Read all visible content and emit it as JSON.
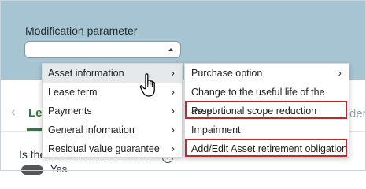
{
  "modification": {
    "label": "Modification parameter",
    "selected_value": ""
  },
  "tabs": {
    "active_label": "Le",
    "right_partial_label": "der"
  },
  "question": {
    "text": "Is there an identified asset?",
    "answer_label": "Yes"
  },
  "menu_left": {
    "items": [
      {
        "label": "Asset information",
        "has_submenu": true
      },
      {
        "label": "Lease term",
        "has_submenu": true
      },
      {
        "label": "Payments",
        "has_submenu": true
      },
      {
        "label": "General information",
        "has_submenu": true
      },
      {
        "label": "Residual value guarantee",
        "has_submenu": true
      }
    ],
    "hovered_index": 0
  },
  "menu_right": {
    "items": [
      {
        "label": "Purchase option",
        "has_submenu": true
      },
      {
        "label": "Change to the useful life of the asset",
        "has_submenu": false
      },
      {
        "label": "Proportional scope reduction",
        "has_submenu": false,
        "highlighted": true
      },
      {
        "label": "Impairment",
        "has_submenu": false
      },
      {
        "label": "Add/Edit Asset retirement obligation",
        "has_submenu": false,
        "highlighted": true
      }
    ]
  },
  "colors": {
    "header_band": "#a7c4d2",
    "accent_green": "#2f7a3a",
    "highlight_red": "#c2262e"
  },
  "icons": {
    "submenu": "chevron-right-icon",
    "select": "caret-up-icon",
    "cursor": "hand-pointer-icon",
    "info": "info-icon"
  }
}
